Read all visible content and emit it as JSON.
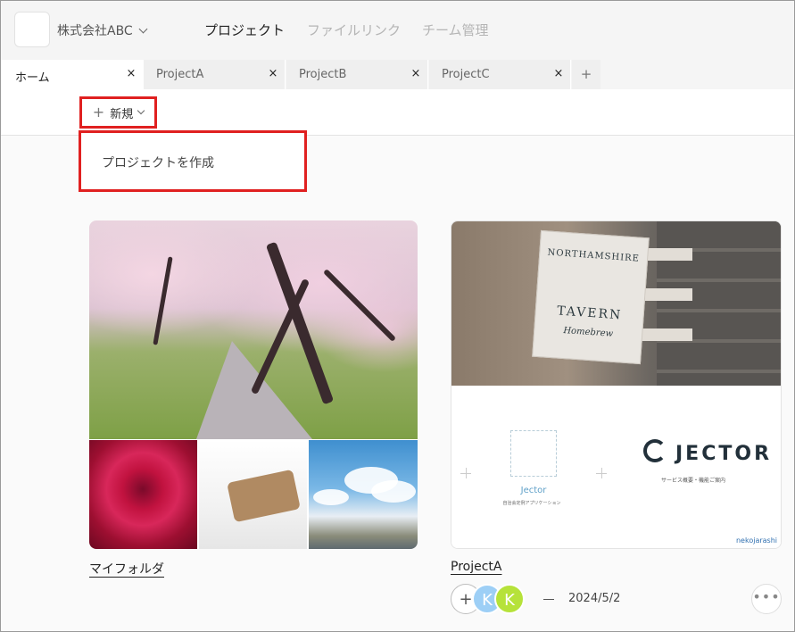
{
  "header": {
    "company": "株式会社ABC",
    "nav": [
      "プロジェクト",
      "ファイルリンク",
      "チーム管理"
    ]
  },
  "tabs": [
    {
      "label": "ホーム",
      "close": "×"
    },
    {
      "label": "ProjectA",
      "close": "×"
    },
    {
      "label": "ProjectB",
      "close": "×"
    },
    {
      "label": "ProjectC",
      "close": "×"
    }
  ],
  "tab_add": "+",
  "toolbar": {
    "new_plus": "+",
    "new_label": "新規"
  },
  "dropdown": {
    "items": [
      "プロジェクトを作成"
    ]
  },
  "cards": [
    {
      "title": "マイフォルダ"
    },
    {
      "title": "ProjectA",
      "sign_lines": [
        "NORTHAMSHIRE",
        "TAVERN",
        "Homebrew"
      ],
      "slide_left_caption": "Jector",
      "slide_left_sub": "自治会定例アプリケーション",
      "slide_brand": "JECTOR",
      "slide_right_sub": "サービス概要・機能ご案内",
      "watermark": "nekojarashi",
      "members": [
        "K",
        "K"
      ],
      "add_member": "+",
      "separator": "—",
      "date": "2024/5/2",
      "more": "•••"
    }
  ],
  "colors": {
    "highlight": "#e02020",
    "avatar1": "#9dcff6",
    "avatar2": "#b6e23a"
  }
}
